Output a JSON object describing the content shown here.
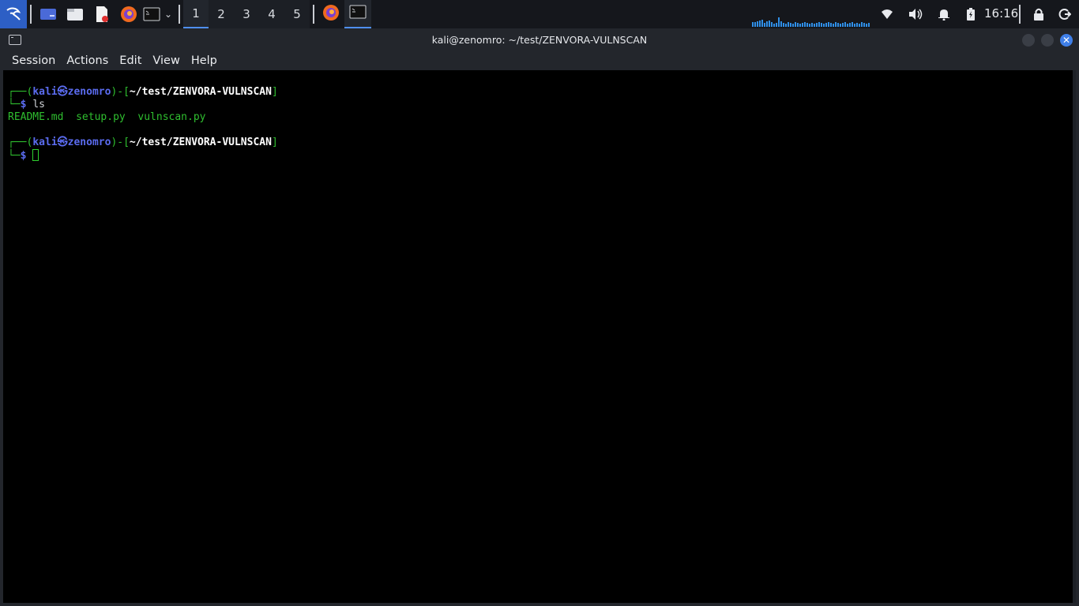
{
  "panel": {
    "workspaces": [
      "1",
      "2",
      "3",
      "4",
      "5"
    ],
    "active_workspace": "1",
    "clock": "16:16",
    "icons": [
      "kali-menu-icon",
      "desktop-icon",
      "file-manager-icon",
      "text-editor-icon",
      "firefox-icon",
      "terminal-icon",
      "chevron-down-icon",
      "firefox-icon",
      "terminal-icon",
      "network-monitor-graph",
      "wifi-icon",
      "volume-icon",
      "bell-icon",
      "battery-icon",
      "lock-icon",
      "logout-icon"
    ],
    "colors": {
      "accent": "#4f8ff0",
      "panel_bg": "#15171c",
      "graph": "#2f8fe8"
    }
  },
  "window": {
    "title": "kali@zenomro: ~/test/ZENVORA-VULNSCAN",
    "menu": [
      "Session",
      "Actions",
      "Edit",
      "View",
      "Help"
    ],
    "close_symbol": "✕"
  },
  "terminal": {
    "user": "kali",
    "at_symbol": "㉿",
    "host": "zenomro",
    "cwd": "~/test/ZENVORA-VULNSCAN",
    "prompt_top_prefix": "┌──(",
    "prompt_mid": ")-[",
    "prompt_end": "]",
    "prompt_bottom": "└─",
    "dollar": "$",
    "command": "ls",
    "files": [
      "README.md",
      "setup.py",
      "vulnscan.py"
    ],
    "colors": {
      "prompt_frame": "#2fbf2f",
      "user_host": "#5b6cf0",
      "cwd": "#ffffff",
      "files": "#2fbf2f"
    }
  }
}
